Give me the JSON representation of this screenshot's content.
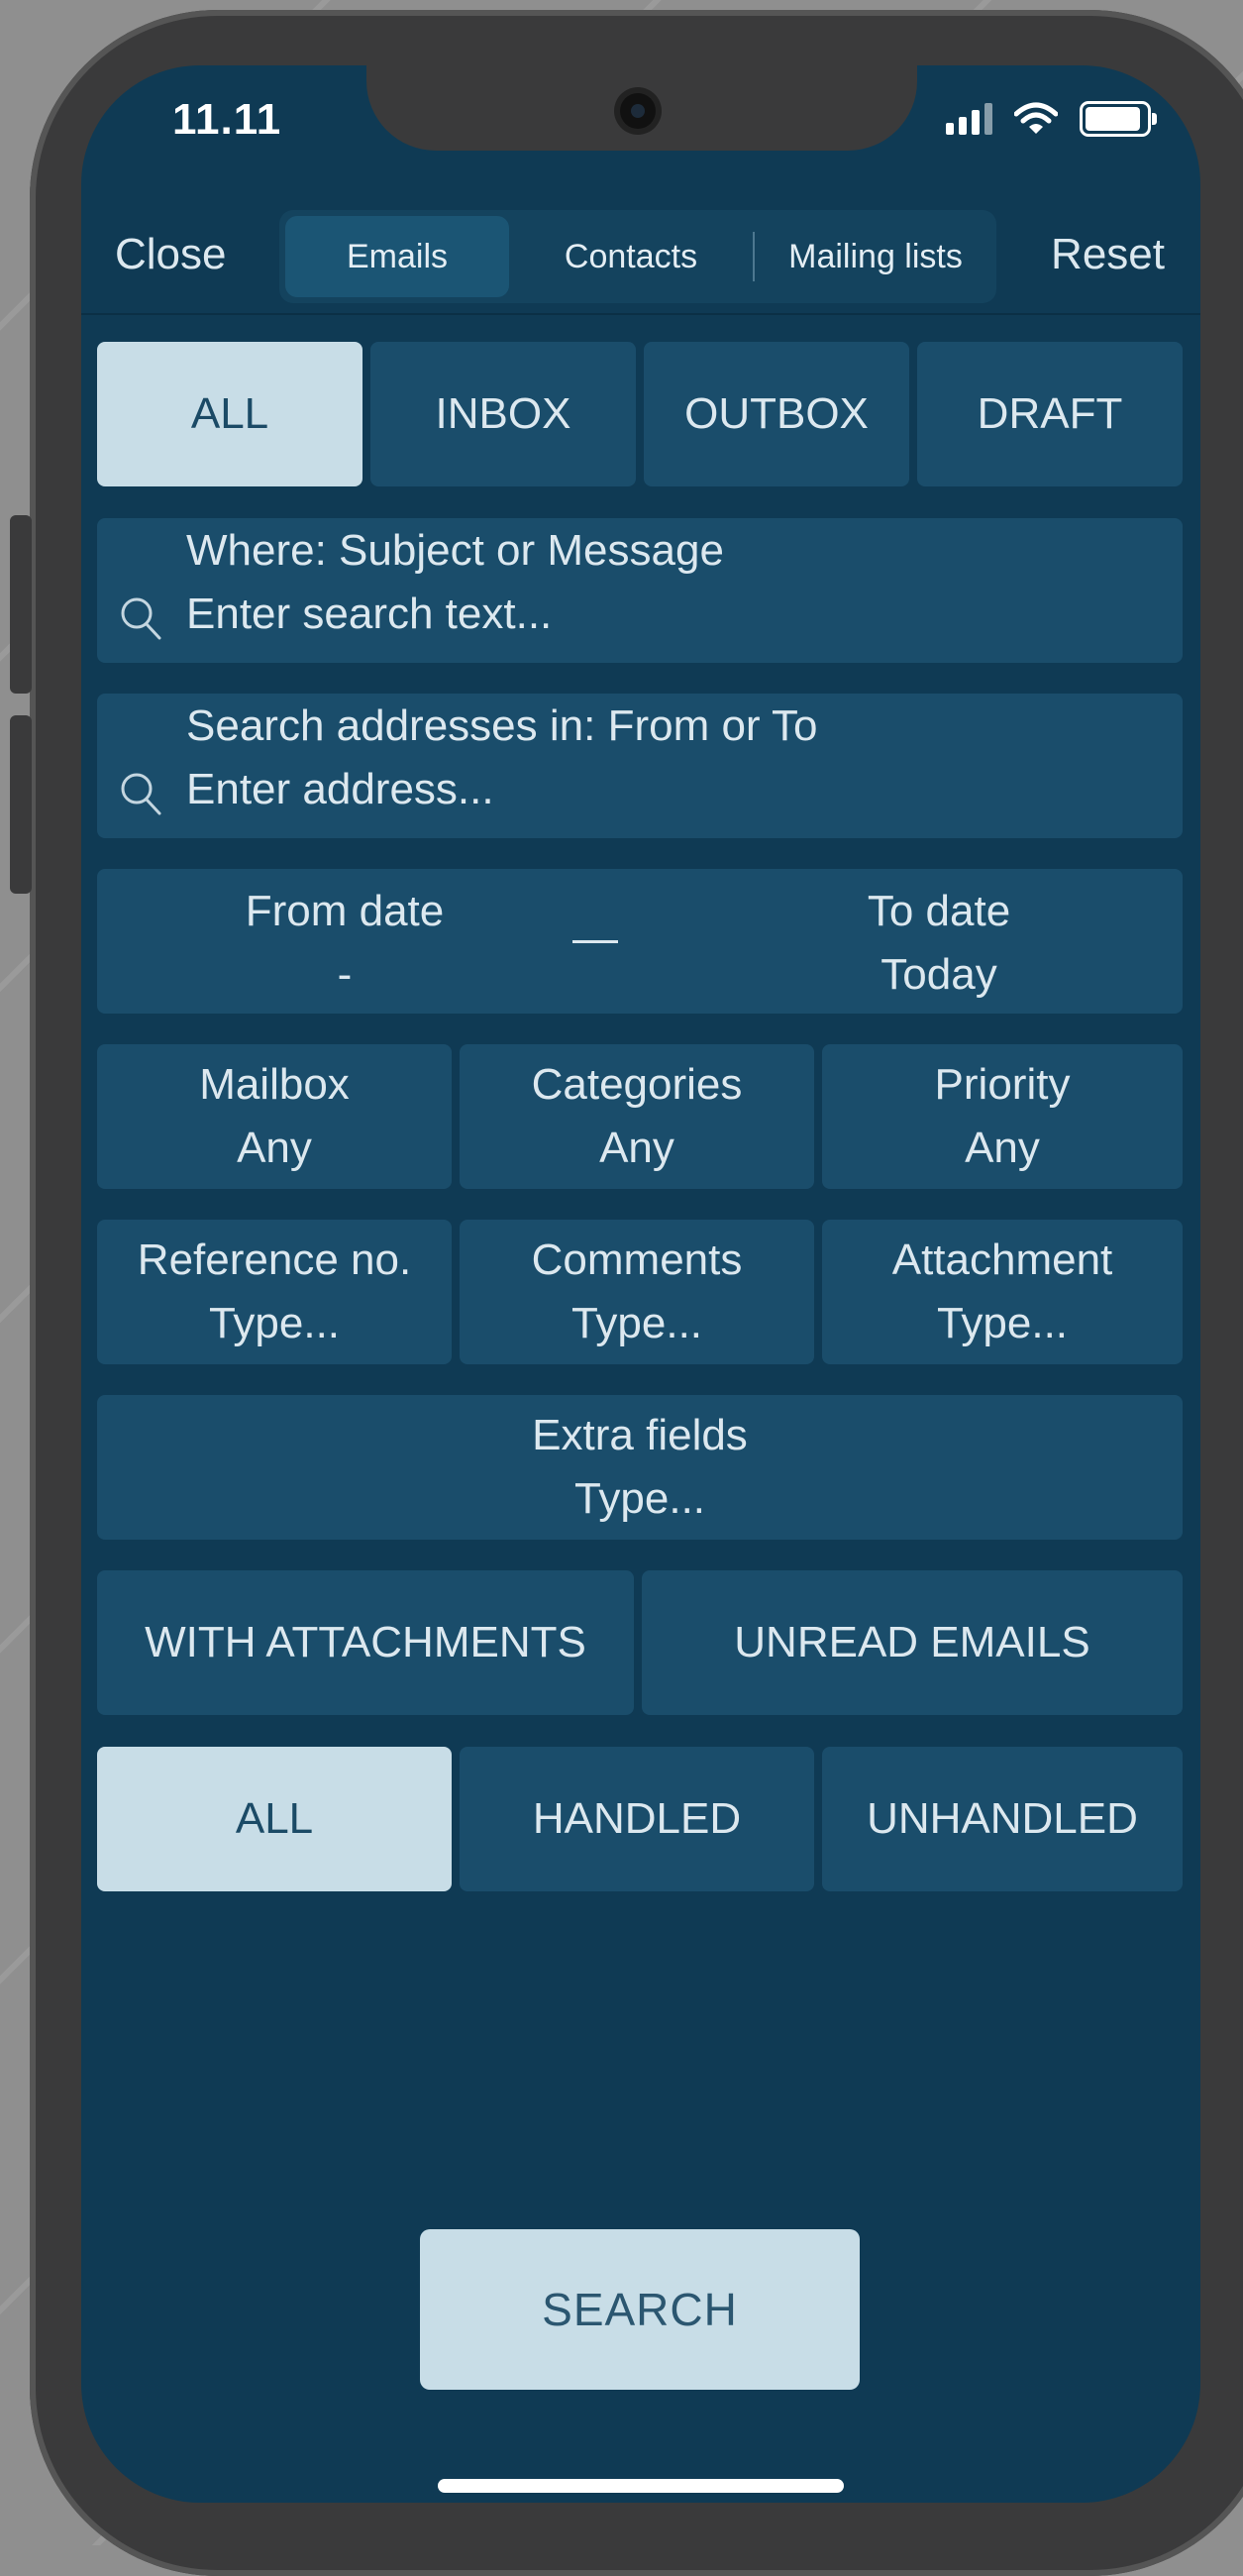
{
  "status_bar": {
    "time": "11.11"
  },
  "header": {
    "close_label": "Close",
    "reset_label": "Reset",
    "tabs": [
      {
        "label": "Emails",
        "selected": true
      },
      {
        "label": "Contacts",
        "selected": false
      },
      {
        "label": "Mailing lists",
        "selected": false
      }
    ]
  },
  "folders": [
    {
      "label": "ALL",
      "selected": true
    },
    {
      "label": "INBOX",
      "selected": false
    },
    {
      "label": "OUTBOX",
      "selected": false
    },
    {
      "label": "DRAFT",
      "selected": false
    }
  ],
  "text_search": {
    "label": "Where: Subject or Message",
    "placeholder": "Enter search text..."
  },
  "address_search": {
    "label": "Search addresses in: From or To",
    "placeholder": "Enter address..."
  },
  "dates": {
    "from_label": "From date",
    "from_value": "-",
    "to_label": "To date",
    "to_value": "Today"
  },
  "filters_row1": [
    {
      "label": "Mailbox",
      "value": "Any"
    },
    {
      "label": "Categories",
      "value": "Any"
    },
    {
      "label": "Priority",
      "value": "Any"
    }
  ],
  "filters_row2": [
    {
      "label": "Reference no.",
      "value": "Type..."
    },
    {
      "label": "Comments",
      "value": "Type..."
    },
    {
      "label": "Attachment",
      "value": "Type..."
    }
  ],
  "extra_fields": {
    "label": "Extra fields",
    "value": "Type..."
  },
  "toggles": {
    "attachments_label": "WITH ATTACHMENTS",
    "unread_label": "UNREAD EMAILS"
  },
  "handled_filter": [
    {
      "label": "ALL",
      "selected": true
    },
    {
      "label": "HANDLED",
      "selected": false
    },
    {
      "label": "UNHANDLED",
      "selected": false
    }
  ],
  "search_button_label": "SEARCH",
  "colors": {
    "screen_bg": "#0f3a54",
    "tile_bg": "#1a4d6b",
    "selected_bg": "#c8dde7",
    "text": "#dce8ef"
  }
}
